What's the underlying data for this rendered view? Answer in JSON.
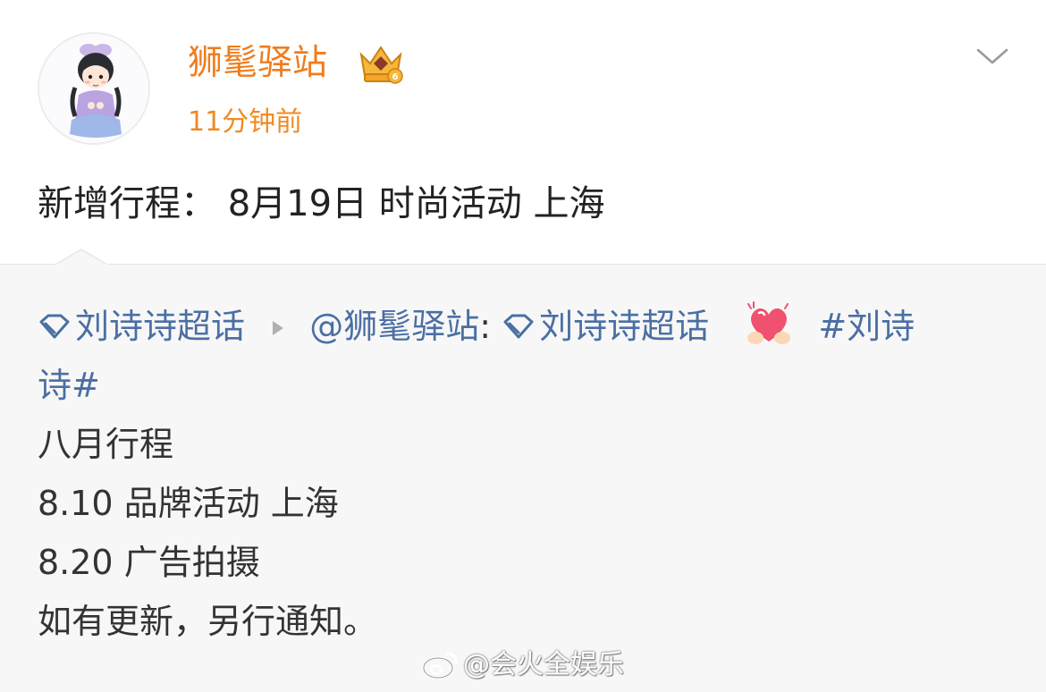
{
  "post": {
    "username": "狮髦驿站",
    "time": "11分钟前",
    "content": "新增行程：  8月19日 时尚活动 上海"
  },
  "repost": {
    "topic_link": "刘诗诗超话",
    "mention": "@狮髦驿站",
    "colon": ":",
    "topic_link_2": "刘诗诗超话",
    "hashtag_part1": "#刘诗",
    "hashtag_part2": "诗#",
    "lines": [
      "八月行程",
      "8.10 品牌活动 上海",
      "8.20 广告拍摄",
      "如有更新，另行通知。"
    ]
  },
  "watermark": "@会火全娱乐",
  "icons": {
    "badge": "crown-badge-icon",
    "menu": "chevron-down-icon",
    "topic": "diamond-icon",
    "separator": "triangle-right-icon",
    "emoji": "heart-hands-icon",
    "brand": "weibo-icon"
  },
  "colors": {
    "username": "#f07c1c",
    "link": "#4b6fa4",
    "repost_bg": "#f7f7f7"
  }
}
